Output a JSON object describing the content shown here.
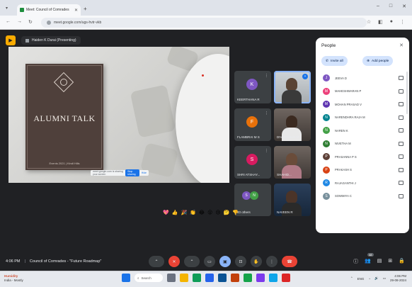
{
  "browser": {
    "tab_title": "Meet: Council of Comrades",
    "url": "meet.google.com/ugs-hvtr-vkb",
    "new_tab": "+",
    "window_controls": [
      "–",
      "□",
      "✕"
    ]
  },
  "meet": {
    "presenting_label": "Haiden K Durai (Presenting)",
    "slide": {
      "title": "ALUMNI TALK",
      "footer": "Events 2021 | Kindl Hills"
    },
    "share_chip": {
      "text": "meet.google.com is sharing your screen",
      "stop": "Stop sharing",
      "hide": "Hide"
    },
    "tiles": [
      {
        "label": "KEERTHANA R",
        "initial": "K",
        "color": "#7e57c2",
        "type": "avatar"
      },
      {
        "label": "",
        "type": "video-person",
        "active": true
      },
      {
        "label": "FLAMBRAI M S",
        "initial": "F",
        "color": "#e8710a",
        "type": "avatar"
      },
      {
        "label": "DIVAKUMAR M",
        "type": "video-dark"
      },
      {
        "label": "SHRI ATSHAY...",
        "initial": "S",
        "color": "#d81b60",
        "type": "avatar"
      },
      {
        "label": "SHAHID...",
        "type": "video-dark"
      },
      {
        "label": "40 others",
        "type": "others"
      },
      {
        "label": "NAVEEN R",
        "type": "video-blue"
      }
    ],
    "reactions": [
      "💖",
      "👍",
      "🎉",
      "👏",
      "😂",
      "😮",
      "😢",
      "🤔",
      "👎"
    ],
    "bottom": {
      "time": "4:06 PM",
      "meeting_name": "Council of Comrades - \"Future Roadmap\"",
      "participant_count": "48"
    }
  },
  "people_panel": {
    "heading": "People",
    "close": "✕",
    "buttons": [
      {
        "label": "Invite all"
      },
      {
        "label": "Add people"
      }
    ],
    "list": [
      {
        "name": "JEEVA D",
        "initial": "J",
        "color": "#7e57c2"
      },
      {
        "name": "MAHESHWARAN P",
        "initial": "M",
        "color": "#ec407a"
      },
      {
        "name": "MOHAN PRASAD V",
        "initial": "M",
        "color": "#5e35b1"
      },
      {
        "name": "NARENDHRA RAJA M",
        "initial": "N",
        "color": "#00838f"
      },
      {
        "name": "NAREN K",
        "initial": "N",
        "color": "#43a047"
      },
      {
        "name": "NIVETHA M",
        "initial": "N",
        "color": "#2e7d32"
      },
      {
        "name": "PRASANNA P S",
        "initial": "P",
        "color": "#5d4037"
      },
      {
        "name": "PRAKASH S",
        "initial": "P",
        "color": "#d84315"
      },
      {
        "name": "RAJAGANTHI J",
        "initial": "R",
        "color": "#1e88e5"
      },
      {
        "name": "SOWMIYA C",
        "initial": "S",
        "color": "#78909c"
      }
    ]
  },
  "taskbar": {
    "weather_temp": "Humidity",
    "weather_desc": "India - Mostly",
    "search": "Search",
    "time": "4:06 PM",
    "date": "29-08-2024",
    "lang": "ENG"
  }
}
